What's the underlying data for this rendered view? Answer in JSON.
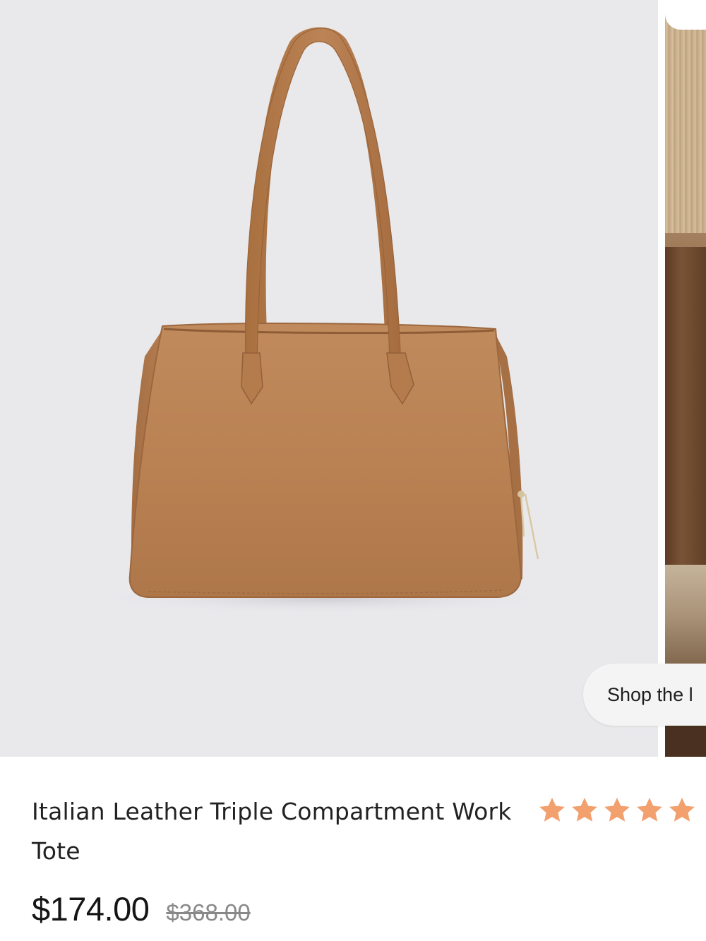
{
  "gallery": {
    "main_image_alt": "Italian Leather Triple Compartment Work Tote in tan",
    "main_image_background": "#e9e9ec",
    "bag_color": "#b87f52",
    "shop_pill_label": "Shop the l"
  },
  "product": {
    "title": "Italian Leather Triple Compartment Work Tote",
    "rating": {
      "stars_filled": 5,
      "stars_total": 5,
      "star_color": "#f2a06e",
      "review_count_visible": "("
    },
    "price": {
      "sale": "$174.00",
      "original": "$368.00"
    }
  },
  "icons": {
    "star": "star-icon"
  }
}
